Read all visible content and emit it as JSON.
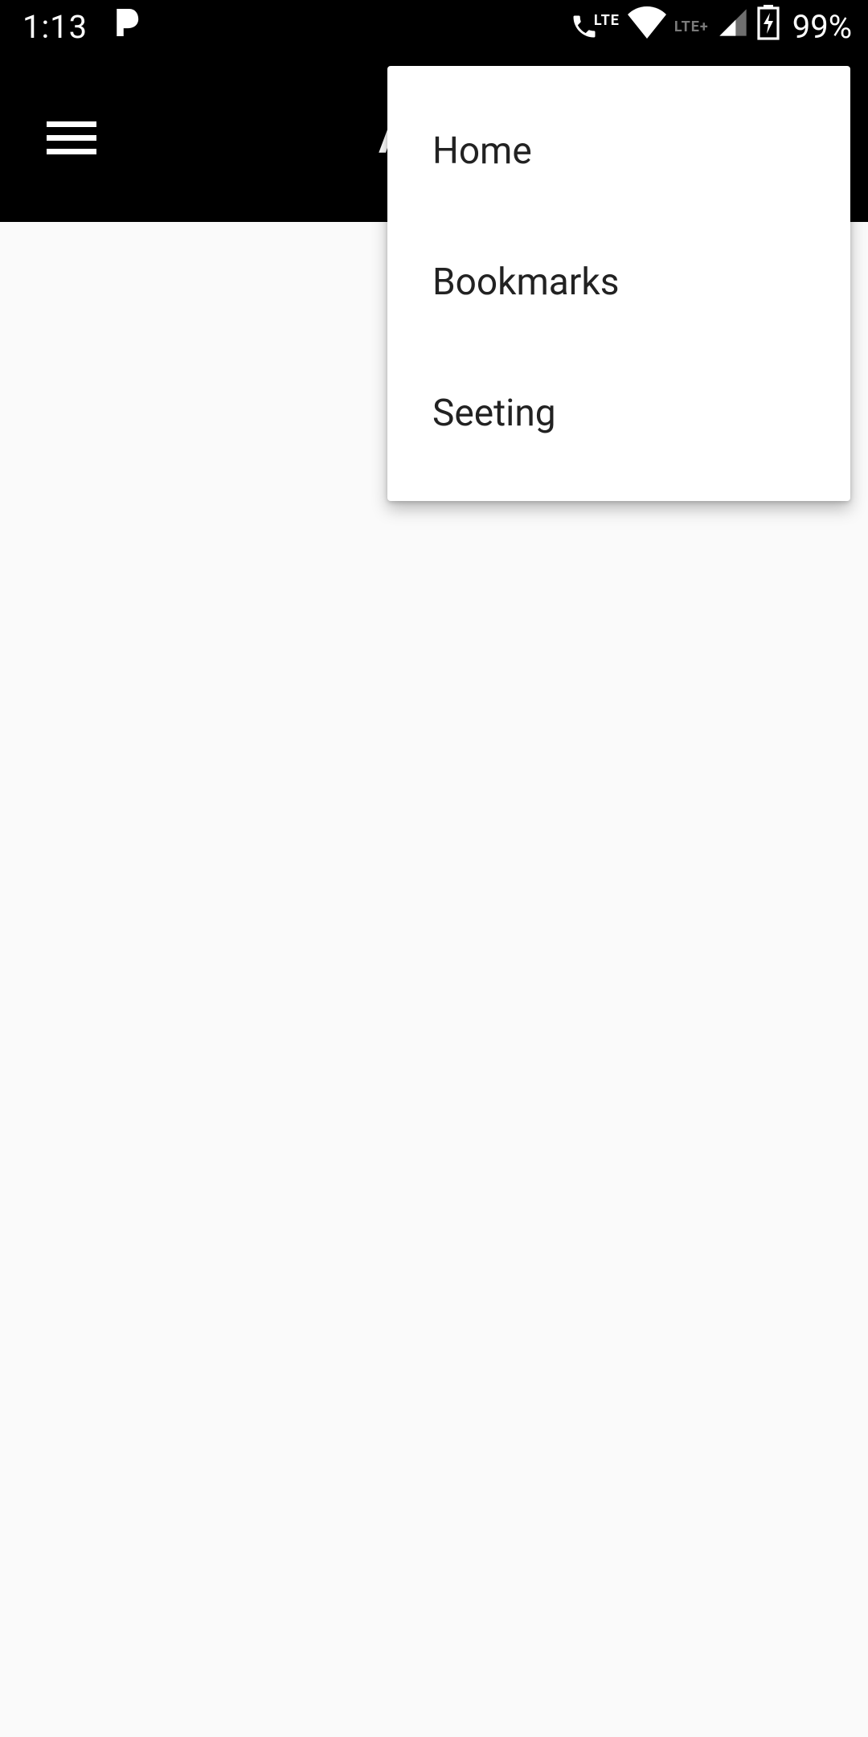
{
  "status_bar": {
    "time": "1:13",
    "lte1": "LTE",
    "lte2": "LTE+",
    "battery_pct": "99%"
  },
  "app_bar": {
    "title": "Appbar"
  },
  "menu": {
    "items": [
      {
        "label": "Home"
      },
      {
        "label": "Bookmarks"
      },
      {
        "label": "Seeting"
      }
    ]
  }
}
